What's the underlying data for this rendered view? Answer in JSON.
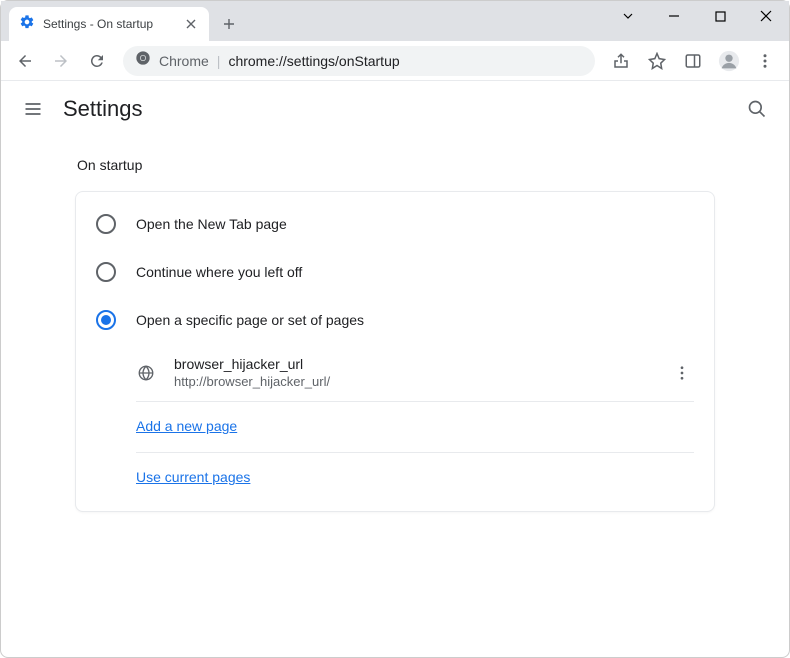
{
  "tab": {
    "title": "Settings - On startup"
  },
  "omnibox": {
    "prefix": "Chrome",
    "url": "chrome://settings/onStartup"
  },
  "header": {
    "title": "Settings"
  },
  "section": {
    "title": "On startup"
  },
  "radios": {
    "new_tab": "Open the New Tab page",
    "continue": "Continue where you left off",
    "specific": "Open a specific page or set of pages"
  },
  "startup_page": {
    "name": "browser_hijacker_url",
    "url": "http://browser_hijacker_url/"
  },
  "links": {
    "add": "Add a new page",
    "current": "Use current pages"
  },
  "colors": {
    "accent": "#1a73e8"
  }
}
